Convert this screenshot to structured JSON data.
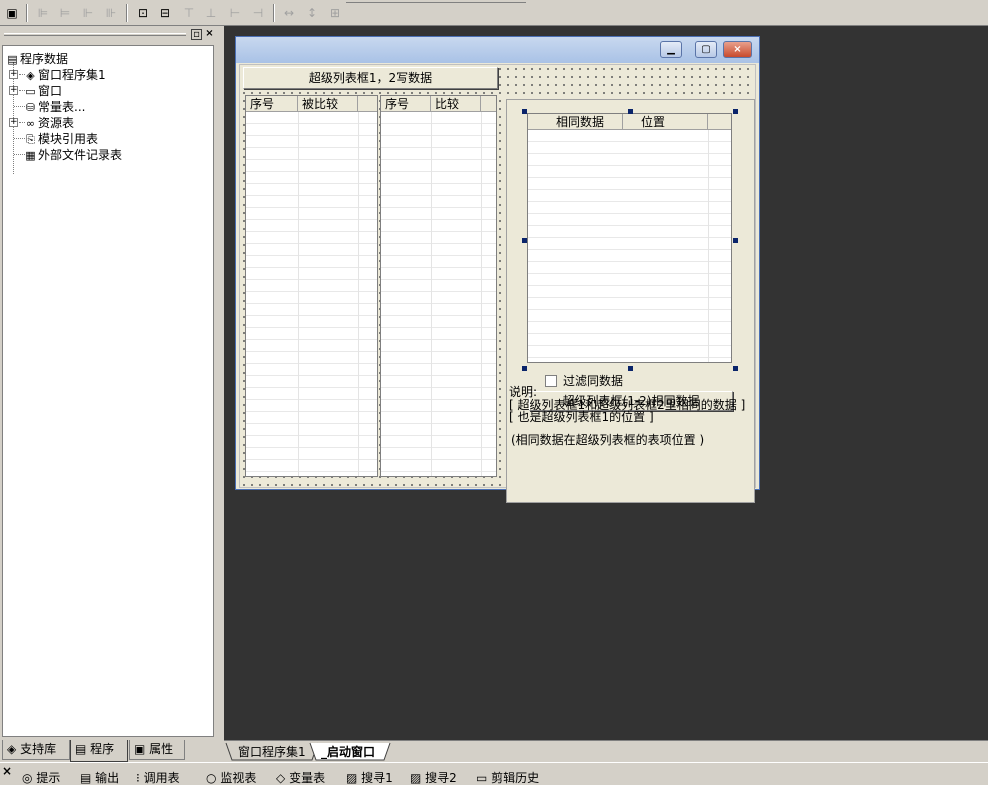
{
  "toolbar": {
    "icons": [
      "form-icon",
      "align-left-icon",
      "align-center-icon",
      "align-right-icon",
      "distribute-icon",
      "center-horizontal-icon",
      "center-vertical-icon",
      "align-top-icon",
      "align-middle-icon",
      "align-bottom-icon",
      "same-width-icon",
      "same-height-icon",
      "same-size-icon"
    ]
  },
  "tree": {
    "root": "程序数据",
    "items": [
      {
        "label": "窗口程序集1",
        "icon": "assembly-icon",
        "expandable": true
      },
      {
        "label": "窗口",
        "icon": "window-icon",
        "expandable": true
      },
      {
        "label": "常量表...",
        "icon": "constant-table-icon",
        "expandable": false
      },
      {
        "label": "资源表",
        "icon": "resource-icon",
        "expandable": true
      },
      {
        "label": "模块引用表",
        "icon": "module-ref-icon",
        "expandable": false
      },
      {
        "label": "外部文件记录表",
        "icon": "external-file-icon",
        "expandable": false
      }
    ]
  },
  "panel_tabs": [
    {
      "label": "支持库"
    },
    {
      "label": "程序"
    },
    {
      "label": "属性"
    }
  ],
  "form": {
    "write_button": "超级列表框1，2写数据",
    "list1_headers": [
      "序号",
      "被比较"
    ],
    "list2_headers": [
      "序号",
      "比较"
    ],
    "list3_headers": [
      "相同数据",
      "位置"
    ],
    "filter_checkbox": "过滤同数据",
    "compare_button": "超级列表框(1-2)相同数据",
    "note_title": "说明:",
    "note_line1": "[ 超级列表框1和超级列表框2里相同的数据 ]",
    "note_line2": "[ 也是超级列表框1的位置 ]",
    "note_line3": "(相同数据在超级列表框的表项位置 )"
  },
  "doc_tabs": [
    {
      "label": "窗口程序集1"
    },
    {
      "label": "_启动窗口"
    }
  ],
  "status": [
    {
      "label": "提示",
      "icon": "hint-icon"
    },
    {
      "label": "输出",
      "icon": "output-icon"
    },
    {
      "label": "调用表",
      "icon": "call-table-icon"
    },
    {
      "label": "监视表",
      "icon": "watch-icon"
    },
    {
      "label": "变量表",
      "icon": "variable-icon"
    },
    {
      "label": "搜寻1",
      "icon": "search1-icon"
    },
    {
      "label": "搜寻2",
      "icon": "search2-icon"
    },
    {
      "label": "剪辑历史",
      "icon": "clip-history-icon"
    }
  ],
  "colors": {
    "canvas": "#333333",
    "chrome": "#d4d0c8",
    "selection": "#0a246a"
  }
}
